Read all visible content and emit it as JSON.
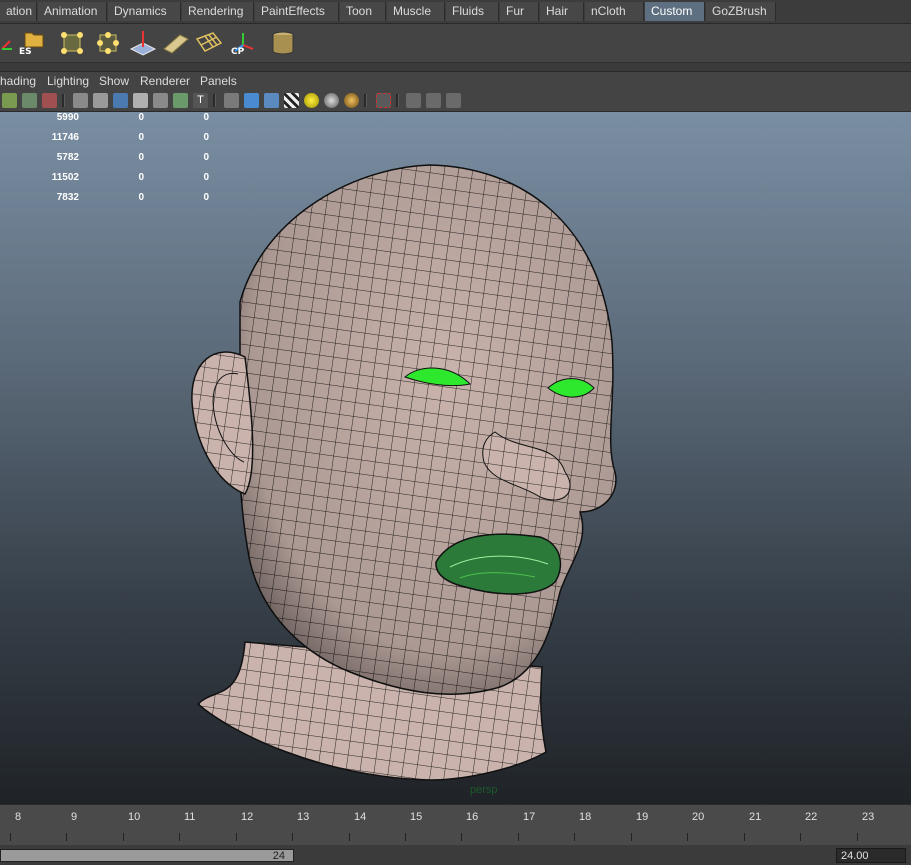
{
  "shelf_tabs": [
    {
      "label": "ation"
    },
    {
      "label": "Animation"
    },
    {
      "label": "Dynamics"
    },
    {
      "label": "Rendering"
    },
    {
      "label": "PaintEffects"
    },
    {
      "label": "Toon"
    },
    {
      "label": "Muscle"
    },
    {
      "label": "Fluids"
    },
    {
      "label": "Fur"
    },
    {
      "label": "Hair"
    },
    {
      "label": "nCloth"
    },
    {
      "label": "Custom"
    },
    {
      "label": "GoZBrush"
    }
  ],
  "active_tab": "Custom",
  "shelf_icons": {
    "es_label": "ES",
    "cp_label": "CP"
  },
  "panel_menu": [
    "hading",
    "Lighting",
    "Show",
    "Renderer",
    "Panels"
  ],
  "hud": [
    {
      "c1": "5990",
      "c2": "0",
      "c3": "0"
    },
    {
      "c1": "11746",
      "c2": "0",
      "c3": "0"
    },
    {
      "c1": "5782",
      "c2": "0",
      "c3": "0"
    },
    {
      "c1": "11502",
      "c2": "0",
      "c3": "0"
    },
    {
      "c1": "7832",
      "c2": "0",
      "c3": "0"
    }
  ],
  "camera_label": "persp",
  "timeline_ticks": [
    "8",
    "9",
    "10",
    "11",
    "12",
    "13",
    "14",
    "15",
    "16",
    "17",
    "18",
    "19",
    "20",
    "21",
    "22",
    "23"
  ],
  "range_end": "24",
  "current_frame": "24.00",
  "colors": {
    "accent": "#5d6f80",
    "eye_green": "#2ee82e",
    "skin": "#c9b3ac"
  }
}
